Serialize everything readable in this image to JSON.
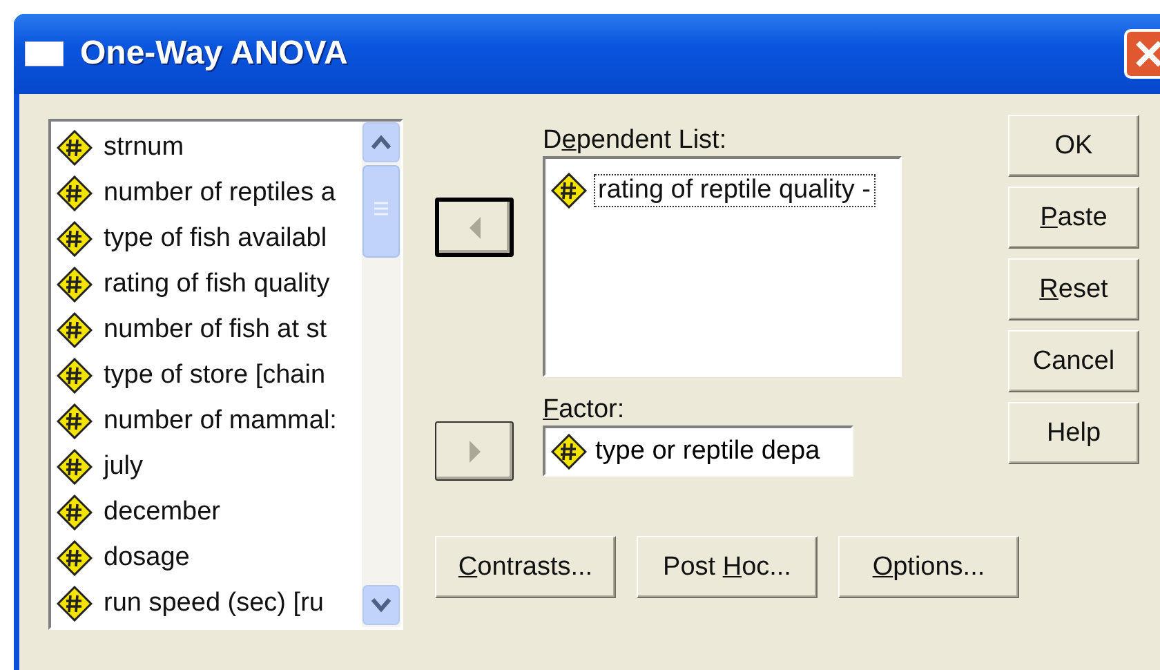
{
  "window": {
    "title": "One-Way ANOVA"
  },
  "variables": [
    {
      "label": "strnum"
    },
    {
      "label": "number of reptiles a"
    },
    {
      "label": "type of fish availabl"
    },
    {
      "label": "rating of fish quality"
    },
    {
      "label": "number of fish at st"
    },
    {
      "label": "type of store [chain"
    },
    {
      "label": "number of mammal:"
    },
    {
      "label": "july"
    },
    {
      "label": "december"
    },
    {
      "label": "dosage"
    },
    {
      "label": "run speed (sec) [ru"
    }
  ],
  "move_buttons": [
    {
      "kind": "left",
      "focused": true
    },
    {
      "kind": "right",
      "focused": false
    }
  ],
  "dependent_list": {
    "label": [
      {
        "text": "D",
        "underlined": false
      },
      {
        "text": "e",
        "underlined": true
      },
      {
        "text": "pendent List:",
        "underlined": false
      }
    ],
    "items": [
      {
        "label": "rating of reptile quality -",
        "focused": true
      }
    ]
  },
  "factor": {
    "label": [
      {
        "text": "F",
        "underlined": true
      },
      {
        "text": "actor:",
        "underlined": false
      }
    ],
    "value": "type or reptile depa"
  },
  "side_buttons": [
    {
      "label": [
        {
          "text": "OK",
          "underlined": false
        }
      ]
    },
    {
      "label": [
        {
          "text": "P",
          "underlined": true
        },
        {
          "text": "aste",
          "underlined": false
        }
      ]
    },
    {
      "label": [
        {
          "text": "R",
          "underlined": true
        },
        {
          "text": "eset",
          "underlined": false
        }
      ]
    },
    {
      "label": [
        {
          "text": "Cancel",
          "underlined": false
        }
      ]
    },
    {
      "label": [
        {
          "text": "Help",
          "underlined": false
        }
      ]
    }
  ],
  "bottom_buttons": [
    {
      "label": [
        {
          "text": "C",
          "underlined": true
        },
        {
          "text": "ontrasts...",
          "underlined": false
        }
      ]
    },
    {
      "label": [
        {
          "text": "Post ",
          "underlined": false
        },
        {
          "text": "H",
          "underlined": true
        },
        {
          "text": "oc...",
          "underlined": false
        }
      ]
    },
    {
      "label": [
        {
          "text": "O",
          "underlined": true
        },
        {
          "text": "ptions...",
          "underlined": false
        }
      ]
    }
  ]
}
